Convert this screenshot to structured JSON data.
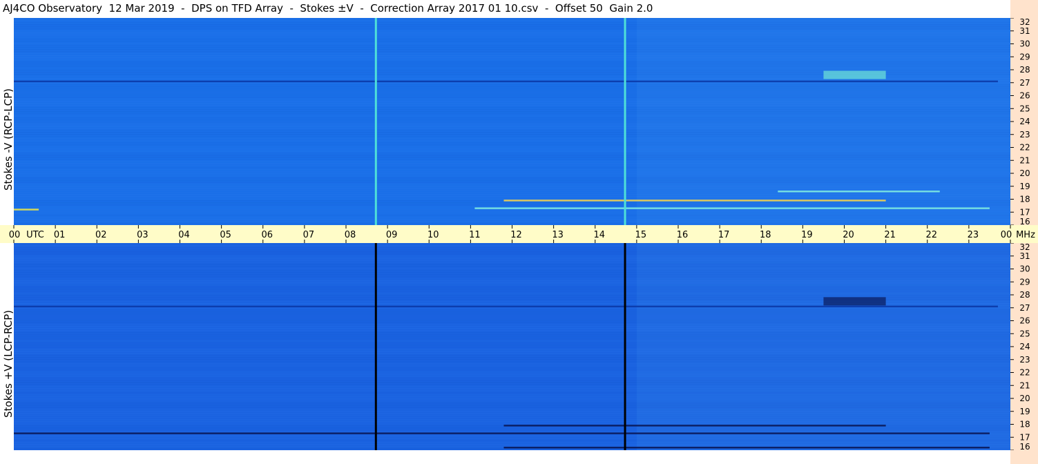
{
  "title": "AJ4CO Observatory  12 Mar 2019  -  DPS on TFD Array  -  Stokes ±V  -  Correction Array 2017 01 10.csv  -  Offset 50  Gain 2.0",
  "chart_data": [
    {
      "type": "heatmap",
      "ylabel": "Stokes -V (RCP-LCP)",
      "ylim": [
        16,
        32
      ],
      "yticks": [
        "16",
        "17",
        "18",
        "19",
        "20",
        "21",
        "22",
        "23",
        "24",
        "25",
        "26",
        "27",
        "28",
        "29",
        "30",
        "31",
        "32"
      ],
      "xlim": [
        0,
        24
      ],
      "vertical_markers_utc": [
        8.72,
        14.72
      ],
      "marker_color": "#4fe0d8",
      "base_color": "#1a6fe8",
      "features": [
        {
          "freq_mhz": 27.1,
          "start_utc": 0.0,
          "end_utc": 23.7,
          "kind": "narrow band"
        },
        {
          "freq_mhz": 17.2,
          "start_utc": 0.0,
          "end_utc": 0.6,
          "kind": "yellow band"
        },
        {
          "freq_mhz": 17.3,
          "start_utc": 11.1,
          "end_utc": 23.5,
          "kind": "bright band"
        },
        {
          "freq_mhz": 17.9,
          "start_utc": 11.8,
          "end_utc": 21.0,
          "kind": "bright band"
        },
        {
          "freq_mhz": 18.6,
          "start_utc": 18.4,
          "end_utc": 22.3,
          "kind": "bright band"
        },
        {
          "freq_mhz": 27.6,
          "start_utc": 19.5,
          "end_utc": 21.0,
          "kind": "burst patch"
        }
      ]
    },
    {
      "type": "heatmap",
      "ylabel": "Stokes +V (LCP-RCP)",
      "ylim": [
        16,
        32
      ],
      "yticks": [
        "16",
        "17",
        "18",
        "19",
        "20",
        "21",
        "22",
        "23",
        "24",
        "25",
        "26",
        "27",
        "28",
        "29",
        "30",
        "31",
        "32"
      ],
      "xlim": [
        0,
        24
      ],
      "vertical_markers_utc": [
        8.72,
        14.72
      ],
      "marker_color": "#000000",
      "base_color": "#1a62e0",
      "features": [
        {
          "freq_mhz": 27.1,
          "start_utc": 0.0,
          "end_utc": 23.7,
          "kind": "narrow band"
        },
        {
          "freq_mhz": 17.3,
          "start_utc": 0.0,
          "end_utc": 23.5,
          "kind": "dark band"
        },
        {
          "freq_mhz": 17.9,
          "start_utc": 11.8,
          "end_utc": 21.0,
          "kind": "dark band"
        },
        {
          "freq_mhz": 16.2,
          "start_utc": 11.8,
          "end_utc": 23.5,
          "kind": "dark band"
        },
        {
          "freq_mhz": 27.5,
          "start_utc": 19.5,
          "end_utc": 21.0,
          "kind": "dark patch"
        }
      ]
    }
  ],
  "time_axis": {
    "labels": [
      "00",
      "UTC",
      "01",
      "02",
      "03",
      "04",
      "05",
      "06",
      "07",
      "08",
      "09",
      "10",
      "11",
      "12",
      "13",
      "14",
      "15",
      "16",
      "17",
      "18",
      "19",
      "20",
      "21",
      "22",
      "23",
      "00",
      "MHz"
    ]
  }
}
